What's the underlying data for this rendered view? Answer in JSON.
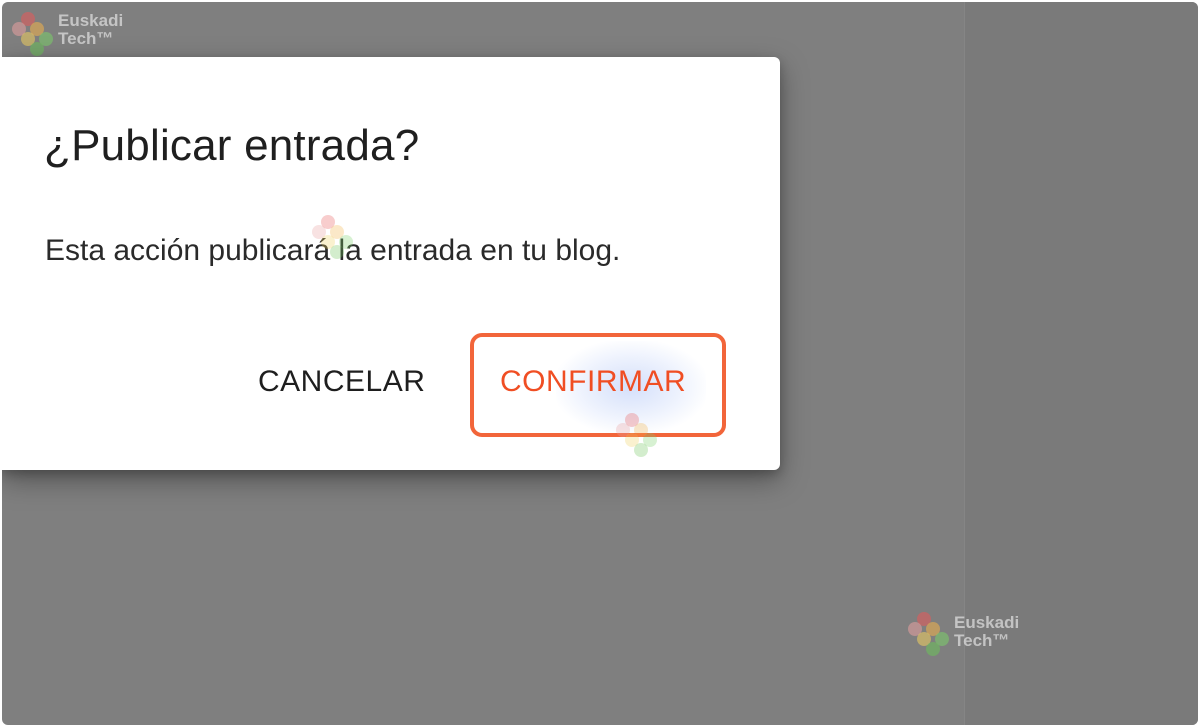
{
  "dialog": {
    "title": "¿Publicar entrada?",
    "body": "Esta acción publicará la entrada en tu blog.",
    "cancel_label": "CANCELAR",
    "confirm_label": "CONFIRMAR"
  },
  "watermark": {
    "line1": "Euskadi",
    "line2": "Tech™"
  },
  "colors": {
    "overlay": "#7f7f7f",
    "confirm_text": "#f04e23",
    "highlight_border": "#f2653a",
    "dialog_bg": "#ffffff"
  }
}
